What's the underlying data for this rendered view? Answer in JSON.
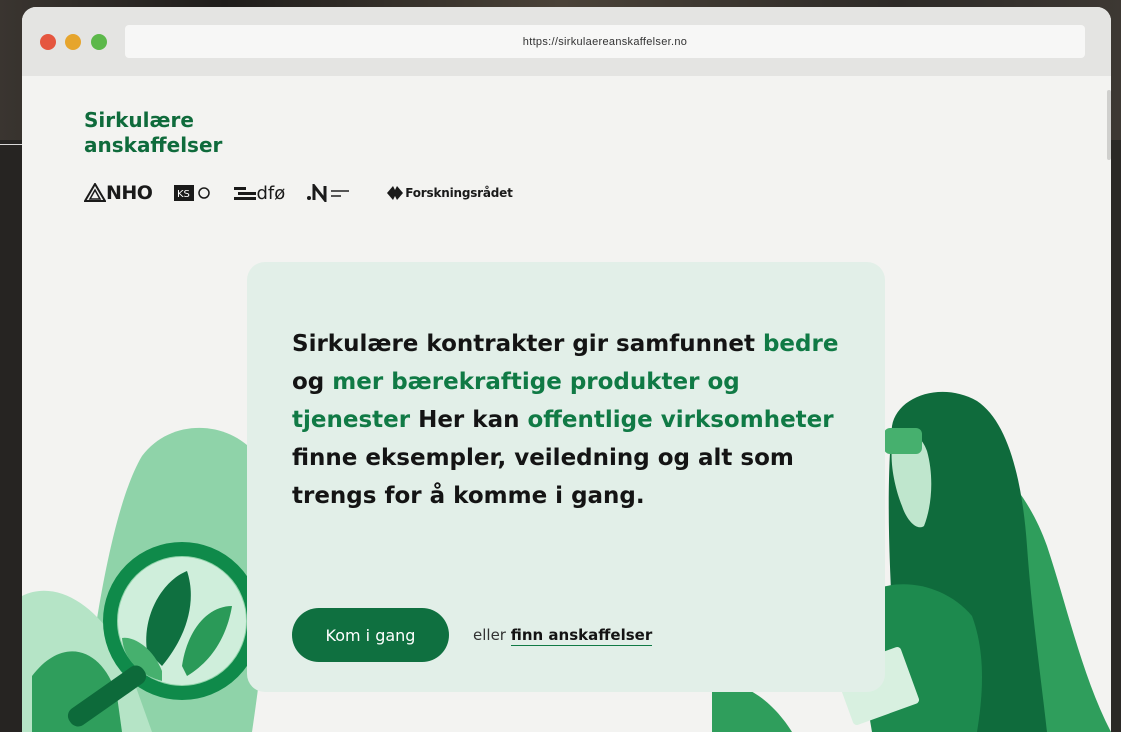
{
  "browser": {
    "url": "https://sirkulaereanskaffelser.no"
  },
  "site": {
    "logo_line1": "Sirkulære",
    "logo_line2": "anskaffelser"
  },
  "partners": [
    {
      "name": "NHO",
      "icon": "nho-logo-icon"
    },
    {
      "name": "KS",
      "icon": "ks-logo-icon"
    },
    {
      "name": "dfø",
      "icon": "dfo-logo-icon"
    },
    {
      "name": "Innovasjon Norge",
      "icon": "innovasjon-norge-logo-icon"
    },
    {
      "name": "Forskningsrådet",
      "icon": "forskningsradet-logo-icon"
    }
  ],
  "hero": {
    "text_1": "Sirkulære kontrakter gir samfunnet ",
    "highlight_1": "bedre",
    "text_2": "og ",
    "highlight_2": "mer bærekraftige produkter og tjenester",
    "text_3": " Her kan ",
    "highlight_3": "offentlige virksomheter",
    "text_4": " finne eksempler, veiledning og alt som trengs for å komme i gang.",
    "cta_label": "Kom i gang",
    "alt_prefix": "eller ",
    "alt_link": "finn anskaffelser"
  },
  "colors": {
    "brand_green": "#0f7040",
    "highlight_green": "#107a45",
    "card_bg": "#e2efe8",
    "page_bg": "#f3f3f1"
  }
}
